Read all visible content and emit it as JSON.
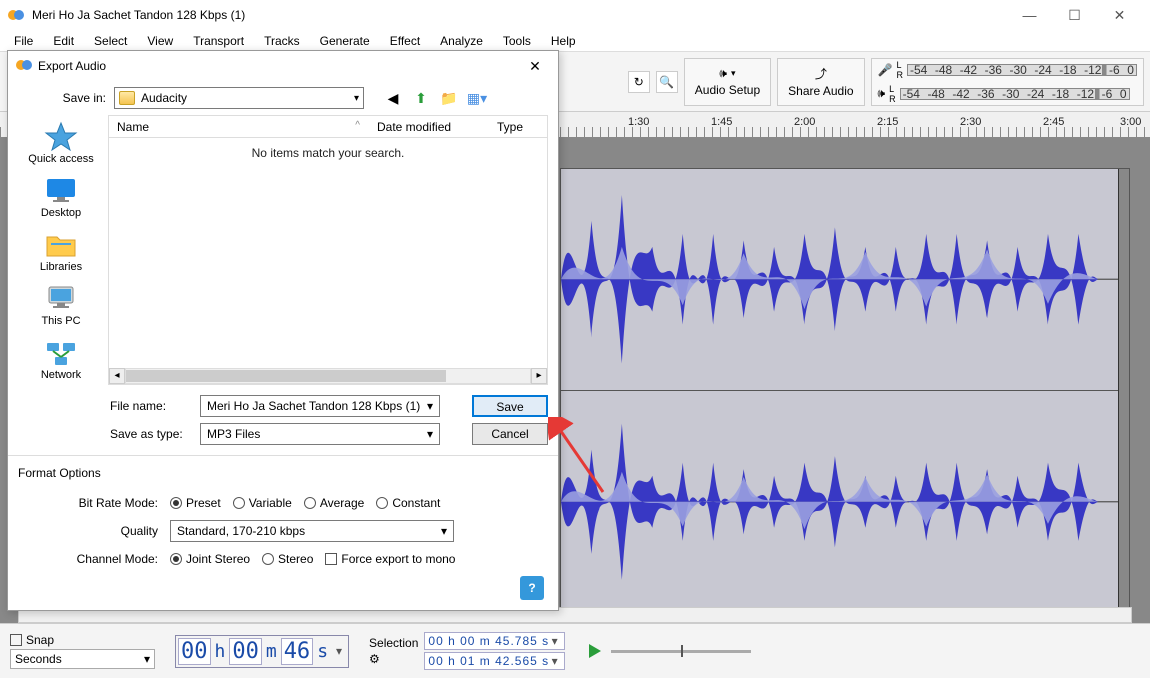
{
  "window": {
    "title": "Meri Ho Ja Sachet Tandon 128 Kbps (1)"
  },
  "menu": {
    "file": "File",
    "edit": "Edit",
    "select": "Select",
    "view": "View",
    "transport": "Transport",
    "tracks": "Tracks",
    "generate": "Generate",
    "effect": "Effect",
    "analyze": "Analyze",
    "tools": "Tools",
    "help": "Help"
  },
  "toolbar": {
    "audio_setup": "Audio Setup",
    "share_audio": "Share Audio",
    "meter_ticks": [
      "-54",
      "-48",
      "-42",
      "-36",
      "-30",
      "-24",
      "-18",
      "-12",
      "-6",
      "0"
    ]
  },
  "ruler": {
    "ticks": [
      "1:30",
      "1:45",
      "2:00",
      "2:15",
      "2:30",
      "2:45",
      "3:00"
    ]
  },
  "bottombar": {
    "snap_label": "Snap",
    "snap_unit": "Seconds",
    "timecode_h": "00",
    "timecode_m": "00",
    "timecode_s": "46",
    "selection_label": "Selection",
    "sel_start": "00 h 00 m 45.785 s",
    "sel_end": "00 h 01 m 42.565 s"
  },
  "dialog": {
    "title": "Export Audio",
    "save_in_label": "Save in:",
    "save_in_value": "Audacity",
    "columns": {
      "name": "Name",
      "date": "Date modified",
      "type": "Type"
    },
    "empty": "No items match your search.",
    "places": {
      "quick": "Quick access",
      "desktop": "Desktop",
      "libraries": "Libraries",
      "thispc": "This PC",
      "network": "Network"
    },
    "file_name_label": "File name:",
    "file_name_value": "Meri Ho Ja Sachet Tandon 128 Kbps (1)",
    "save_as_label": "Save as type:",
    "save_as_value": "MP3 Files",
    "save_btn": "Save",
    "cancel_btn": "Cancel",
    "format_header": "Format Options",
    "bitrate_label": "Bit Rate Mode:",
    "bitrate_options": {
      "preset": "Preset",
      "variable": "Variable",
      "average": "Average",
      "constant": "Constant"
    },
    "quality_label": "Quality",
    "quality_value": "Standard, 170-210 kbps",
    "channel_label": "Channel Mode:",
    "channel_options": {
      "joint": "Joint Stereo",
      "stereo": "Stereo"
    },
    "force_mono": "Force export to mono"
  }
}
